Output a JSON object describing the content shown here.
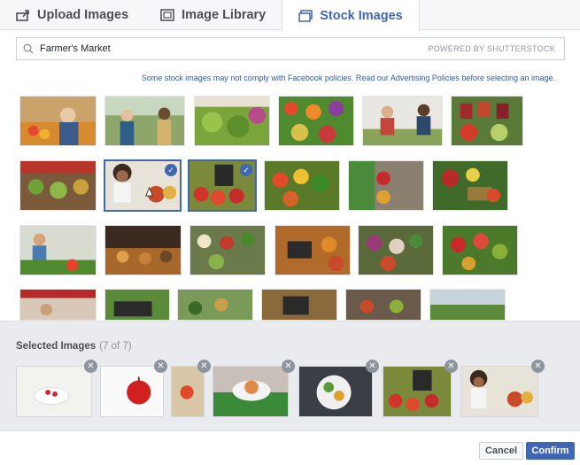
{
  "tabs": [
    {
      "label": "Upload Images",
      "icon": "upload-icon"
    },
    {
      "label": "Image Library",
      "icon": "library-icon"
    },
    {
      "label": "Stock Images",
      "icon": "stock-images-icon"
    }
  ],
  "search": {
    "value": "Farmer's Market",
    "powered_by": "POWERED BY SHUTTERSTOCK"
  },
  "policy_text": "Some stock images may not comply with Facebook policies. Read our Advertising Policies before selecting an image.",
  "selected": {
    "title": "Selected Images",
    "count": "(7 of 7)"
  },
  "footer": {
    "cancel_label": "Cancel",
    "confirm_label": "Confirm"
  },
  "colors": {
    "accent": "#4267b2",
    "link": "#365899",
    "panel": "#e9ebee"
  },
  "check_glyph": "✓",
  "remove_glyph": "✕"
}
